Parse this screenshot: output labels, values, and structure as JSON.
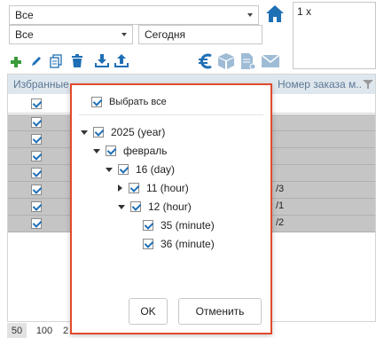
{
  "filters": {
    "select_1": "Все",
    "select_2": "Все",
    "date_field": "Сегодня",
    "note": "1 x"
  },
  "grid": {
    "col_favorites": "Избранные",
    "col_order_number": "Номер заказа м...",
    "rows": [
      {
        "checked": true,
        "value": ""
      },
      {
        "checked": true,
        "value": ""
      },
      {
        "checked": true,
        "value": ""
      },
      {
        "checked": true,
        "value": ""
      },
      {
        "checked": true,
        "value": "/3"
      },
      {
        "checked": true,
        "value": "/1"
      },
      {
        "checked": true,
        "value": "/2"
      }
    ]
  },
  "pager": {
    "sizes": [
      "50",
      "100",
      "2"
    ]
  },
  "popup": {
    "select_all_label": "Выбрать все",
    "tree": [
      {
        "label": "2025 (year)"
      },
      {
        "label": "февраль"
      },
      {
        "label": "16 (day)"
      },
      {
        "label": "11 (hour)"
      },
      {
        "label": "12 (hour)"
      },
      {
        "label": "35 (minute)"
      },
      {
        "label": "36 (minute)"
      }
    ],
    "ok_label": "OK",
    "cancel_label": "Отменить"
  },
  "icons": {
    "home": "home-icon",
    "add": "plus-icon",
    "edit": "pencil-icon",
    "copy": "copy-icon",
    "delete": "trash-icon",
    "download": "download-icon",
    "upload": "upload-icon",
    "euro": "euro-icon",
    "box": "box-icon",
    "document": "document-icon",
    "mail": "mail-icon",
    "filter": "filter-icon"
  },
  "colors": {
    "accent": "#1f6fb5",
    "popup_border": "#e24a2b",
    "green": "#3a9a3a"
  }
}
